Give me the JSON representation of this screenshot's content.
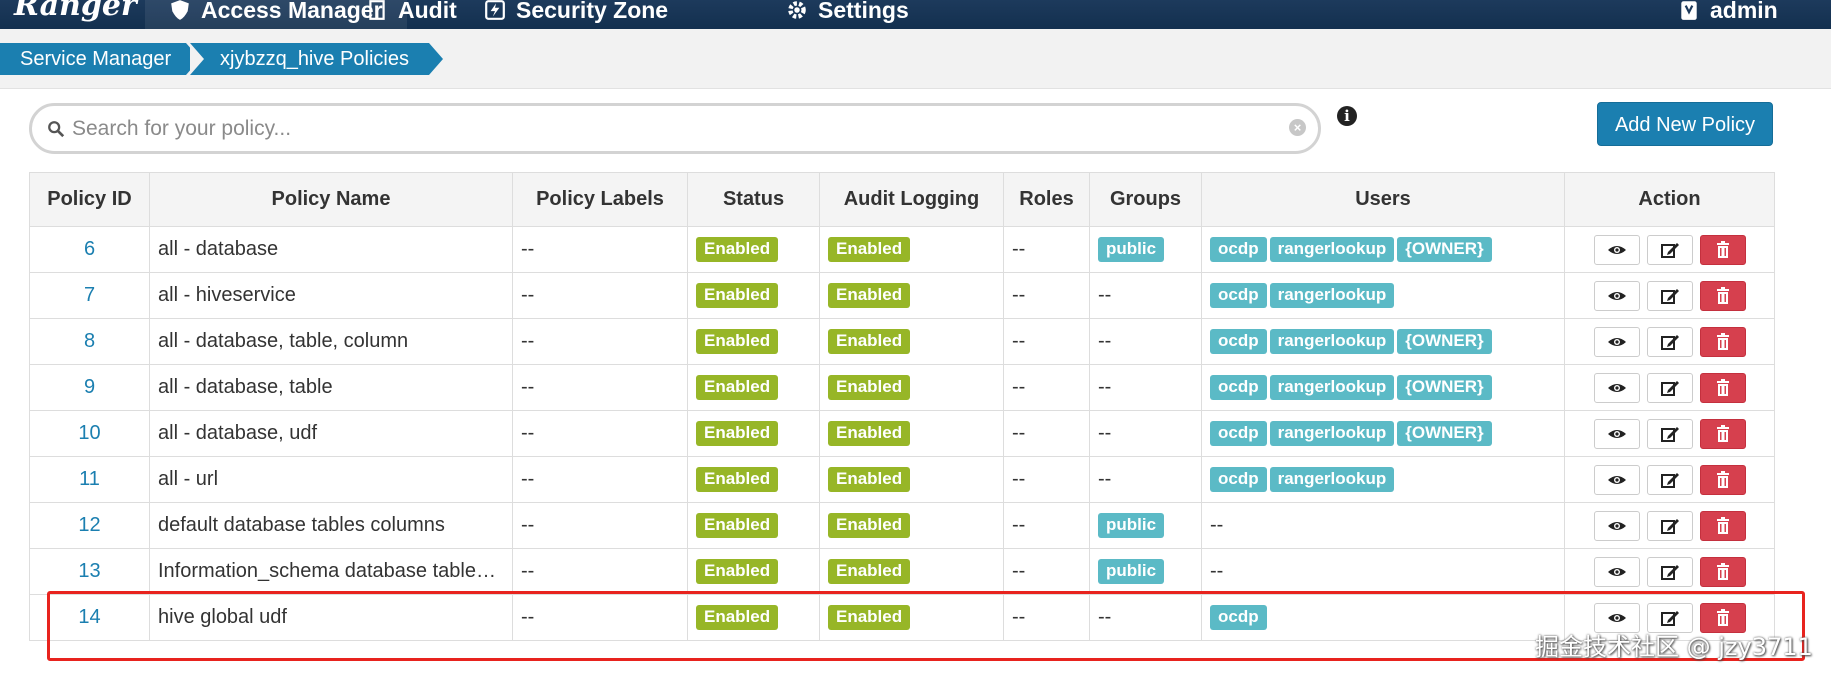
{
  "nav": {
    "brand": "Ranger",
    "items": [
      {
        "label": "Access Manager"
      },
      {
        "label": "Audit"
      },
      {
        "label": "Security Zone"
      },
      {
        "label": "Settings"
      }
    ],
    "user": "admin"
  },
  "breadcrumb": [
    "Service Manager",
    "xjybzzq_hive Policies"
  ],
  "search": {
    "placeholder": "Search for your policy...",
    "value": ""
  },
  "add_button": "Add New Policy",
  "table": {
    "headers": [
      "Policy ID",
      "Policy Name",
      "Policy Labels",
      "Status",
      "Audit Logging",
      "Roles",
      "Groups",
      "Users",
      "Action"
    ],
    "rows": [
      {
        "id": "6",
        "name": "all - database",
        "labels": "--",
        "status": "Enabled",
        "audit": "Enabled",
        "roles": "--",
        "groups": [
          "public"
        ],
        "groups_text": "",
        "users": [
          "ocdp",
          "rangerlookup",
          "{OWNER}"
        ],
        "users_text": ""
      },
      {
        "id": "7",
        "name": "all - hiveservice",
        "labels": "--",
        "status": "Enabled",
        "audit": "Enabled",
        "roles": "--",
        "groups": [],
        "groups_text": "--",
        "users": [
          "ocdp",
          "rangerlookup"
        ],
        "users_text": ""
      },
      {
        "id": "8",
        "name": "all - database, table, column",
        "labels": "--",
        "status": "Enabled",
        "audit": "Enabled",
        "roles": "--",
        "groups": [],
        "groups_text": "--",
        "users": [
          "ocdp",
          "rangerlookup",
          "{OWNER}"
        ],
        "users_text": ""
      },
      {
        "id": "9",
        "name": "all - database, table",
        "labels": "--",
        "status": "Enabled",
        "audit": "Enabled",
        "roles": "--",
        "groups": [],
        "groups_text": "--",
        "users": [
          "ocdp",
          "rangerlookup",
          "{OWNER}"
        ],
        "users_text": ""
      },
      {
        "id": "10",
        "name": "all - database, udf",
        "labels": "--",
        "status": "Enabled",
        "audit": "Enabled",
        "roles": "--",
        "groups": [],
        "groups_text": "--",
        "users": [
          "ocdp",
          "rangerlookup",
          "{OWNER}"
        ],
        "users_text": ""
      },
      {
        "id": "11",
        "name": "all - url",
        "labels": "--",
        "status": "Enabled",
        "audit": "Enabled",
        "roles": "--",
        "groups": [],
        "groups_text": "--",
        "users": [
          "ocdp",
          "rangerlookup"
        ],
        "users_text": ""
      },
      {
        "id": "12",
        "name": "default database tables columns",
        "labels": "--",
        "status": "Enabled",
        "audit": "Enabled",
        "roles": "--",
        "groups": [
          "public"
        ],
        "groups_text": "",
        "users": [],
        "users_text": "--"
      },
      {
        "id": "13",
        "name": "Information_schema database tables columns",
        "labels": "--",
        "status": "Enabled",
        "audit": "Enabled",
        "roles": "--",
        "groups": [
          "public"
        ],
        "groups_text": "",
        "users": [],
        "users_text": "--"
      },
      {
        "id": "14",
        "name": "hive global udf",
        "labels": "--",
        "status": "Enabled",
        "audit": "Enabled",
        "roles": "--",
        "groups": [],
        "groups_text": "--",
        "users": [
          "ocdp"
        ],
        "users_text": ""
      }
    ]
  },
  "watermark": "掘金技术社区 @ jzy3711",
  "colors": {
    "primary": "#1b7fb0",
    "enabled": "#97b627",
    "tag": "#5bbac6",
    "delete": "#d6404e",
    "nav": "#1d3a5c",
    "highlight": "#e8231e"
  }
}
